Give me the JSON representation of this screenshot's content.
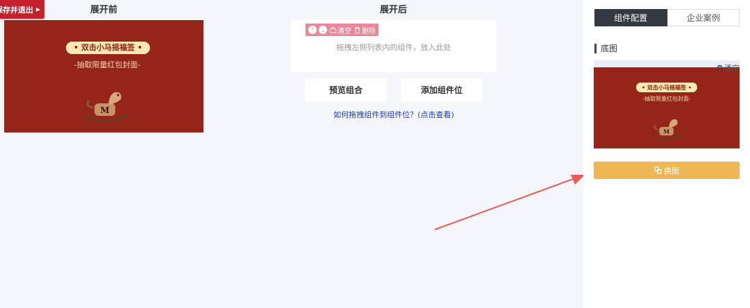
{
  "header": {
    "save_exit_label": "保存并退出",
    "before_title": "展开前",
    "after_title": "展开后"
  },
  "cover": {
    "pill_text": "• 双击小马摇福签 •",
    "sub_text": "-抽取限量红包封面-",
    "bg_color": "#952519",
    "pill_color": "#fbe9b3"
  },
  "toolbar": {
    "up_icon": "chevron-up-icon",
    "down_icon": "chevron-down-icon",
    "clear_label": "清空",
    "delete_label": "删除"
  },
  "canvas": {
    "drop_hint": "拖拽左侧列表内的组件，放入此处"
  },
  "actions": {
    "preview_label": "预览组合",
    "add_slot_label": "添加组件位",
    "help_link": "如何拖拽组件到组件位？(点击查看)"
  },
  "right_panel": {
    "tabs": [
      {
        "label": "组件配置",
        "active": true
      },
      {
        "label": "企业案例",
        "active": false
      }
    ],
    "section_title": "底图",
    "clear_label": "清空",
    "swap_label": "换图",
    "swap_color": "#efb656"
  }
}
